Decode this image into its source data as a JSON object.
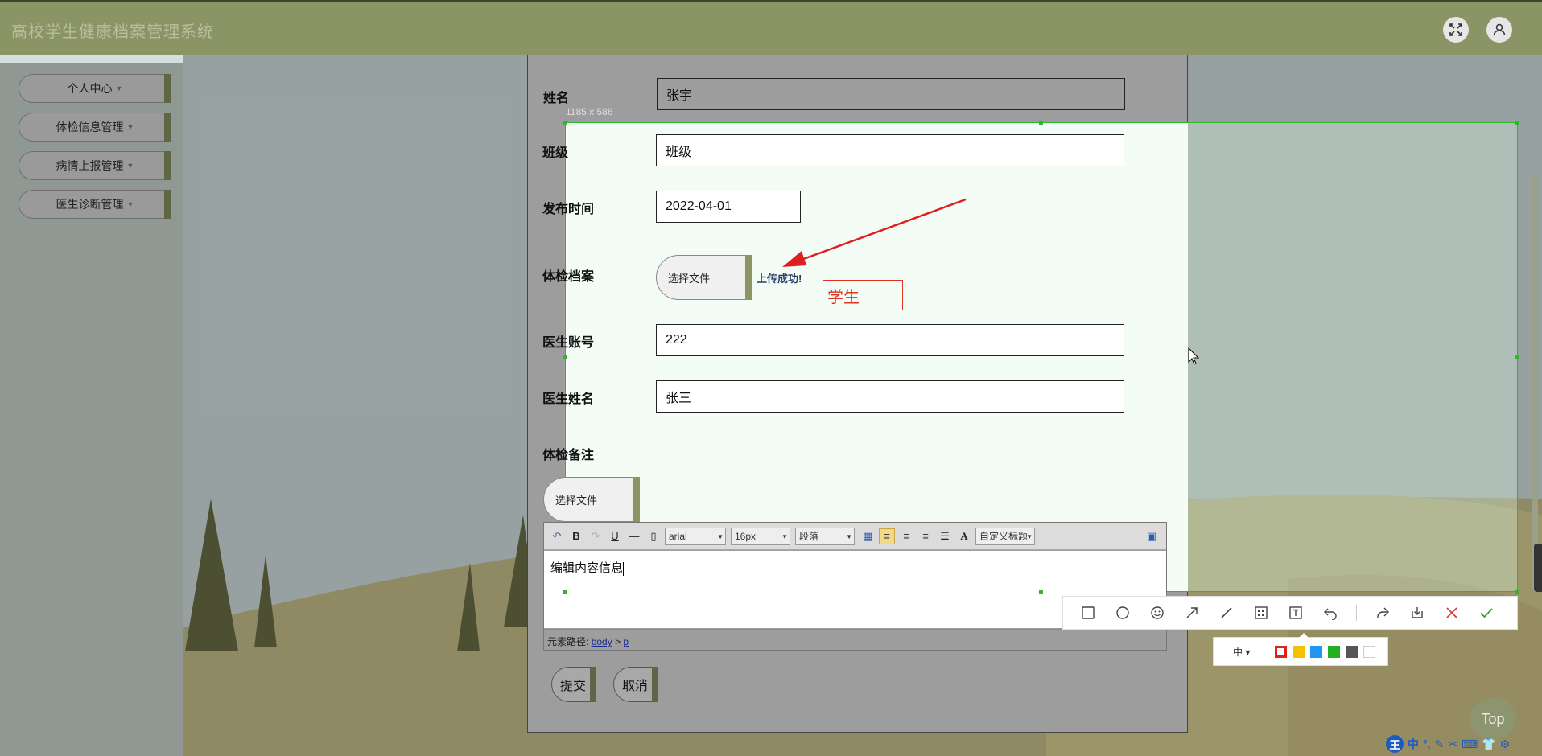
{
  "app": {
    "title": "高校学生健康档案管理系统"
  },
  "header": {
    "fullscreen_icon": "fullscreen-icon",
    "user_icon": "user-icon"
  },
  "sidebar": {
    "items": [
      {
        "label": "个人中心"
      },
      {
        "label": "体检信息管理"
      },
      {
        "label": "病情上报管理"
      },
      {
        "label": "医生诊断管理"
      }
    ]
  },
  "form": {
    "name": {
      "label": "姓名",
      "value": "张宇"
    },
    "class": {
      "label": "班级",
      "value": "班级"
    },
    "publish_time": {
      "label": "发布时间",
      "value": "2022-04-01"
    },
    "archive": {
      "label": "体检档案",
      "file_button": "选择文件",
      "status": "上传成功!"
    },
    "doctor_account": {
      "label": "医生账号",
      "value": "222"
    },
    "doctor_name": {
      "label": "医生姓名",
      "value": "张三"
    },
    "remark": {
      "label": "体检备注",
      "file_button": "选择文件"
    },
    "editor": {
      "font_family": "arial",
      "font_size": "16px",
      "paragraph": "段落",
      "custom_title": "自定义标题",
      "content": "编辑内容信息",
      "path_label": "元素路径:",
      "path_body": "body",
      "path_sep": ">",
      "path_p": "p"
    },
    "submit": "提交",
    "cancel": "取消"
  },
  "screenshot_tool": {
    "size_label": "1185 x 586",
    "annotation_text": "学生",
    "size_picker": "中",
    "colors": [
      "#e02020",
      "#f5c000",
      "#2196f3",
      "#22b022",
      "#555555",
      "#ffffff"
    ]
  },
  "misc": {
    "top_button": "Top",
    "ime_label": "中"
  }
}
